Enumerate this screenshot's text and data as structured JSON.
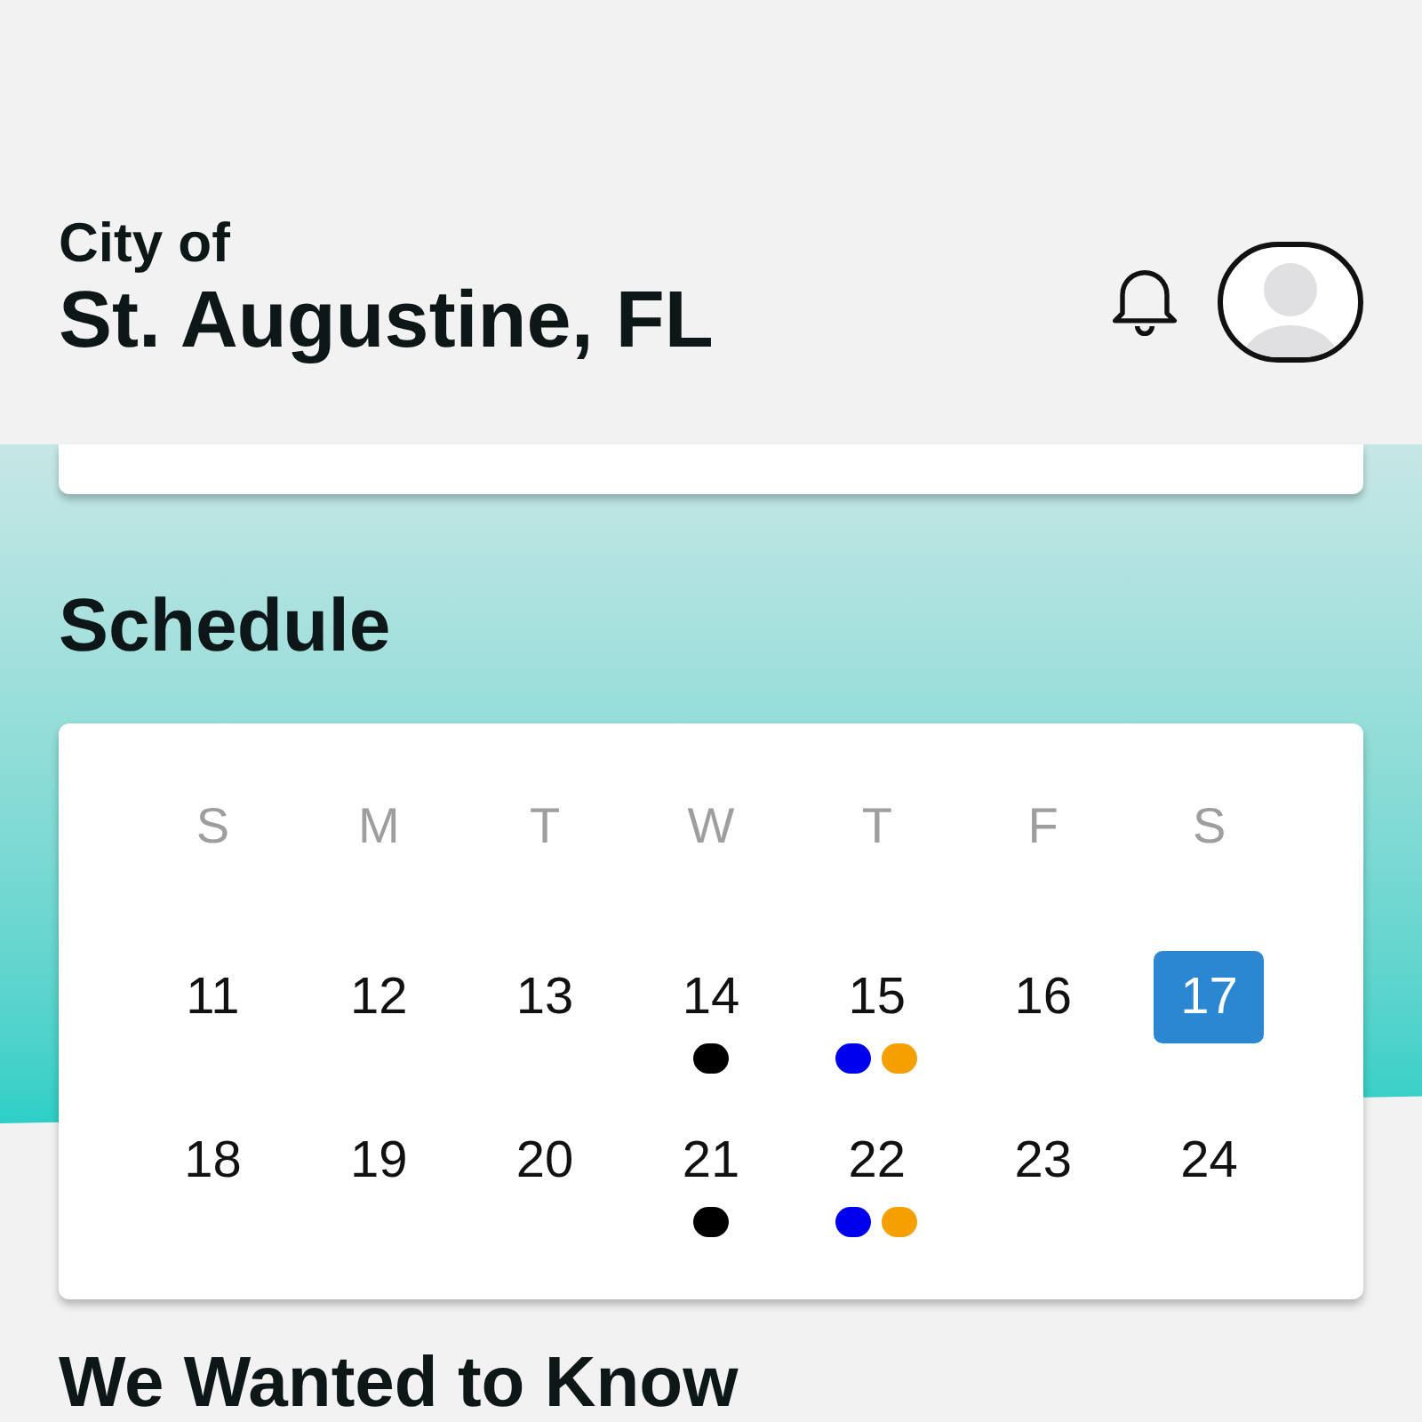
{
  "header": {
    "subtitle": "City of",
    "title": "St. Augustine, FL"
  },
  "schedule": {
    "heading": "Schedule",
    "weekdays": [
      "S",
      "M",
      "T",
      "W",
      "T",
      "F",
      "S"
    ],
    "weeks": [
      [
        {
          "label": "11",
          "selected": false
        },
        {
          "label": "12",
          "selected": false
        },
        {
          "label": "13",
          "selected": false
        },
        {
          "label": "14",
          "selected": false,
          "events": [
            {
              "color": "#000000"
            }
          ]
        },
        {
          "label": "15",
          "selected": false,
          "events": [
            {
              "color": "#0000ee"
            },
            {
              "color": "#f5a000"
            }
          ]
        },
        {
          "label": "16",
          "selected": false
        },
        {
          "label": "17",
          "selected": true
        }
      ],
      [
        {
          "label": "18",
          "selected": false
        },
        {
          "label": "19",
          "selected": false
        },
        {
          "label": "20",
          "selected": false
        },
        {
          "label": "21",
          "selected": false,
          "events": [
            {
              "color": "#000000"
            }
          ]
        },
        {
          "label": "22",
          "selected": false,
          "events": [
            {
              "color": "#0000ee"
            },
            {
              "color": "#f5a000"
            }
          ]
        },
        {
          "label": "23",
          "selected": false
        },
        {
          "label": "24",
          "selected": false
        }
      ]
    ]
  },
  "next_section": {
    "heading": "We Wanted to Know"
  }
}
